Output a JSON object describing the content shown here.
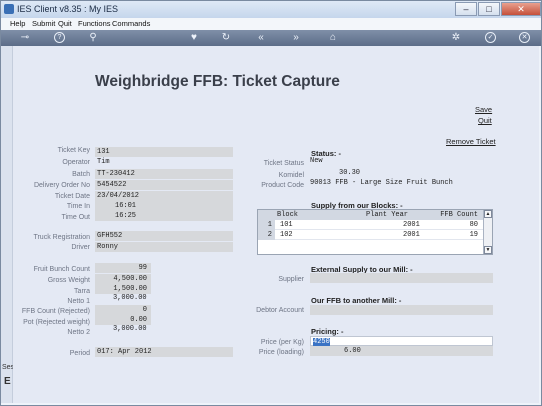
{
  "window": {
    "title": "IES Client v8.35 : My IES"
  },
  "menu": [
    "Help",
    "Submit",
    "Quit",
    "Functions",
    "Commands"
  ],
  "page": {
    "title": "Weighbridge FFB: Ticket Capture"
  },
  "links": {
    "save": "Save",
    "quit": "Quit",
    "remove": "Remove Ticket"
  },
  "ticket": {
    "key": {
      "label": "Ticket Key",
      "value": "131"
    },
    "operator": {
      "label": "Operator",
      "value": "Tim"
    },
    "batch": {
      "label": "Batch",
      "value": "TT-230412"
    },
    "delivery_order": {
      "label": "Delivery Order No",
      "value": "5454522"
    },
    "date": {
      "label": "Ticket Date",
      "value": "23/04/2012"
    },
    "time_in": {
      "label": "Time In",
      "value": "16:01"
    },
    "time_out": {
      "label": "Time Out",
      "value": "16:25"
    },
    "truck": {
      "label": "Truck Registration",
      "value": "GFH552"
    },
    "driver": {
      "label": "Driver",
      "value": "Ronny"
    },
    "fruit_bunch_count": {
      "label": "Fruit Bunch Count",
      "value": "99"
    },
    "gross_weight": {
      "label": "Gross Weight",
      "value": "4,500.00"
    },
    "tarra": {
      "label": "Tarra",
      "value": "1,500.00"
    },
    "netto1": {
      "label": "Netto 1",
      "value": "3,000.00"
    },
    "ffb_rejected": {
      "label": "FFB Count (Rejected)",
      "value": "0"
    },
    "pot_rejected": {
      "label": "Pot (Rejected weight)",
      "value": "0.00"
    },
    "netto2": {
      "label": "Netto 2",
      "value": "3,000.00"
    },
    "period": {
      "label": "Period",
      "value": "017: Apr 2012"
    }
  },
  "status": {
    "heading": "Status: -",
    "ticket_status": {
      "label": "Ticket Status",
      "value": "New"
    },
    "komidel": {
      "label": "Komidel",
      "value": "30.30"
    },
    "product_code": {
      "label": "Product Code",
      "value": "90013 FFB - Large Size Fruit Bunch"
    }
  },
  "supply": {
    "heading": "Supply from our Blocks: -",
    "columns": [
      "Block",
      "Plant Year",
      "FFB Count"
    ],
    "rows": [
      {
        "n": "1",
        "block": "101",
        "year": "2001",
        "count": "80"
      },
      {
        "n": "2",
        "block": "102",
        "year": "2001",
        "count": "19"
      }
    ]
  },
  "external": {
    "heading": "External Supply to our Mill: -",
    "supplier_label": "Supplier",
    "supplier_value": ""
  },
  "other_mill": {
    "heading": "Our FFB to another Mill: -",
    "debtor_label": "Debtor Account",
    "debtor_value": ""
  },
  "pricing": {
    "heading": "Pricing: -",
    "price_kg": {
      "label": "Price (per Kg)",
      "value": "4250"
    },
    "price_loading": {
      "label": "Price (loading)",
      "value": "6.00"
    }
  },
  "sidebar": {
    "text1": "Ses",
    "text2": "E"
  }
}
